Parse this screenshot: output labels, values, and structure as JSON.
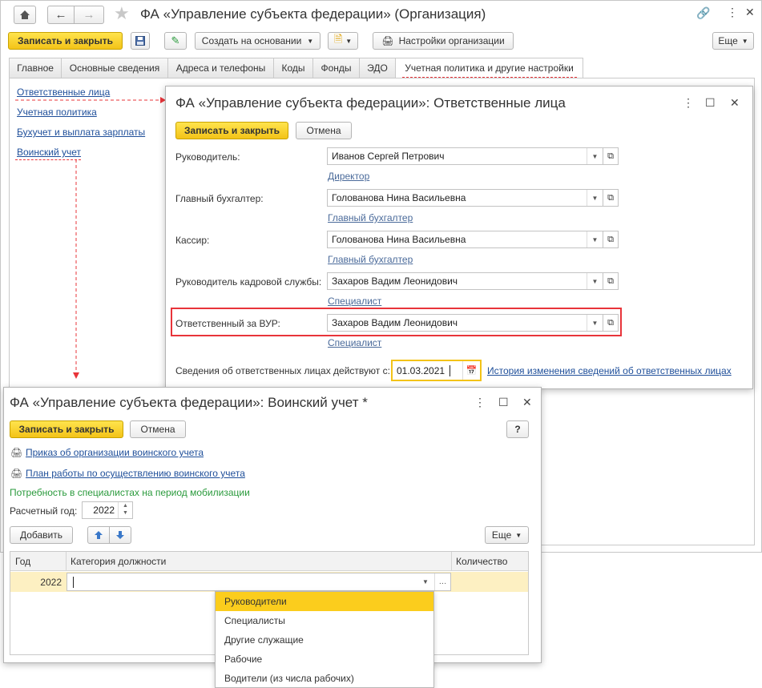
{
  "main_window": {
    "title": "ФА «Управление субъекта федерации» (Организация)",
    "save_close": "Записать и закрыть",
    "create_based": "Создать на основании",
    "org_settings": "Настройки организации",
    "more": "Еще",
    "tabs": [
      {
        "label": "Главное"
      },
      {
        "label": "Основные сведения"
      },
      {
        "label": "Адреса и телефоны"
      },
      {
        "label": "Коды"
      },
      {
        "label": "Фонды"
      },
      {
        "label": "ЭДО"
      },
      {
        "label": "Учетная политика и другие настройки"
      }
    ],
    "side_links": [
      {
        "label": "Ответственные лица"
      },
      {
        "label": "Учетная политика"
      },
      {
        "label": "Бухучет и выплата зарплаты"
      },
      {
        "label": "Воинский учет"
      }
    ]
  },
  "resp_window": {
    "title": "ФА «Управление субъекта федерации»: Ответственные лица",
    "save_close": "Записать и закрыть",
    "cancel": "Отмена",
    "rows": [
      {
        "label": "Руководитель:",
        "value": "Иванов Сергей Петрович",
        "position": "Директор"
      },
      {
        "label": "Главный бухгалтер:",
        "value": "Голованова Нина Васильевна",
        "position": "Главный бухгалтер"
      },
      {
        "label": "Кассир:",
        "value": "Голованова Нина Васильевна",
        "position": "Главный бухгалтер"
      },
      {
        "label": "Руководитель кадровой службы:",
        "value": "Захаров Вадим Леонидович",
        "position": "Специалист"
      },
      {
        "label": "Ответственный за ВУР:",
        "value": "Захаров Вадим Леонидович",
        "position": "Специалист"
      }
    ],
    "effective_label": "Сведения об ответственных лицах действуют с:",
    "effective_date": "01.03.2021",
    "history_link": "История изменения сведений об ответственных лицах"
  },
  "military_window": {
    "title": "ФА «Управление субъекта федерации»: Воинский учет *",
    "save_close": "Записать и закрыть",
    "cancel": "Отмена",
    "help": "?",
    "print_link_1": "Приказ об организации воинского учета",
    "print_link_2": "План работы по осуществлению воинского учета",
    "section_title": "Потребность в специалистах на период мобилизации",
    "year_label": "Расчетный год:",
    "year_value": "2022",
    "add": "Добавить",
    "more": "Еще",
    "columns": {
      "year": "Год",
      "category": "Категория должности",
      "quantity": "Количество"
    },
    "row": {
      "year": "2022"
    },
    "dropdown": [
      {
        "label": "Руководители"
      },
      {
        "label": "Специалисты"
      },
      {
        "label": "Другие служащие"
      },
      {
        "label": "Рабочие"
      },
      {
        "label": "Водители (из числа рабочих)"
      }
    ]
  },
  "colors": {
    "accent_yellow": "#f3c318",
    "highlight_red": "#e8343a",
    "link_blue": "#1f4f9a",
    "green_text": "#2a9a3c"
  }
}
